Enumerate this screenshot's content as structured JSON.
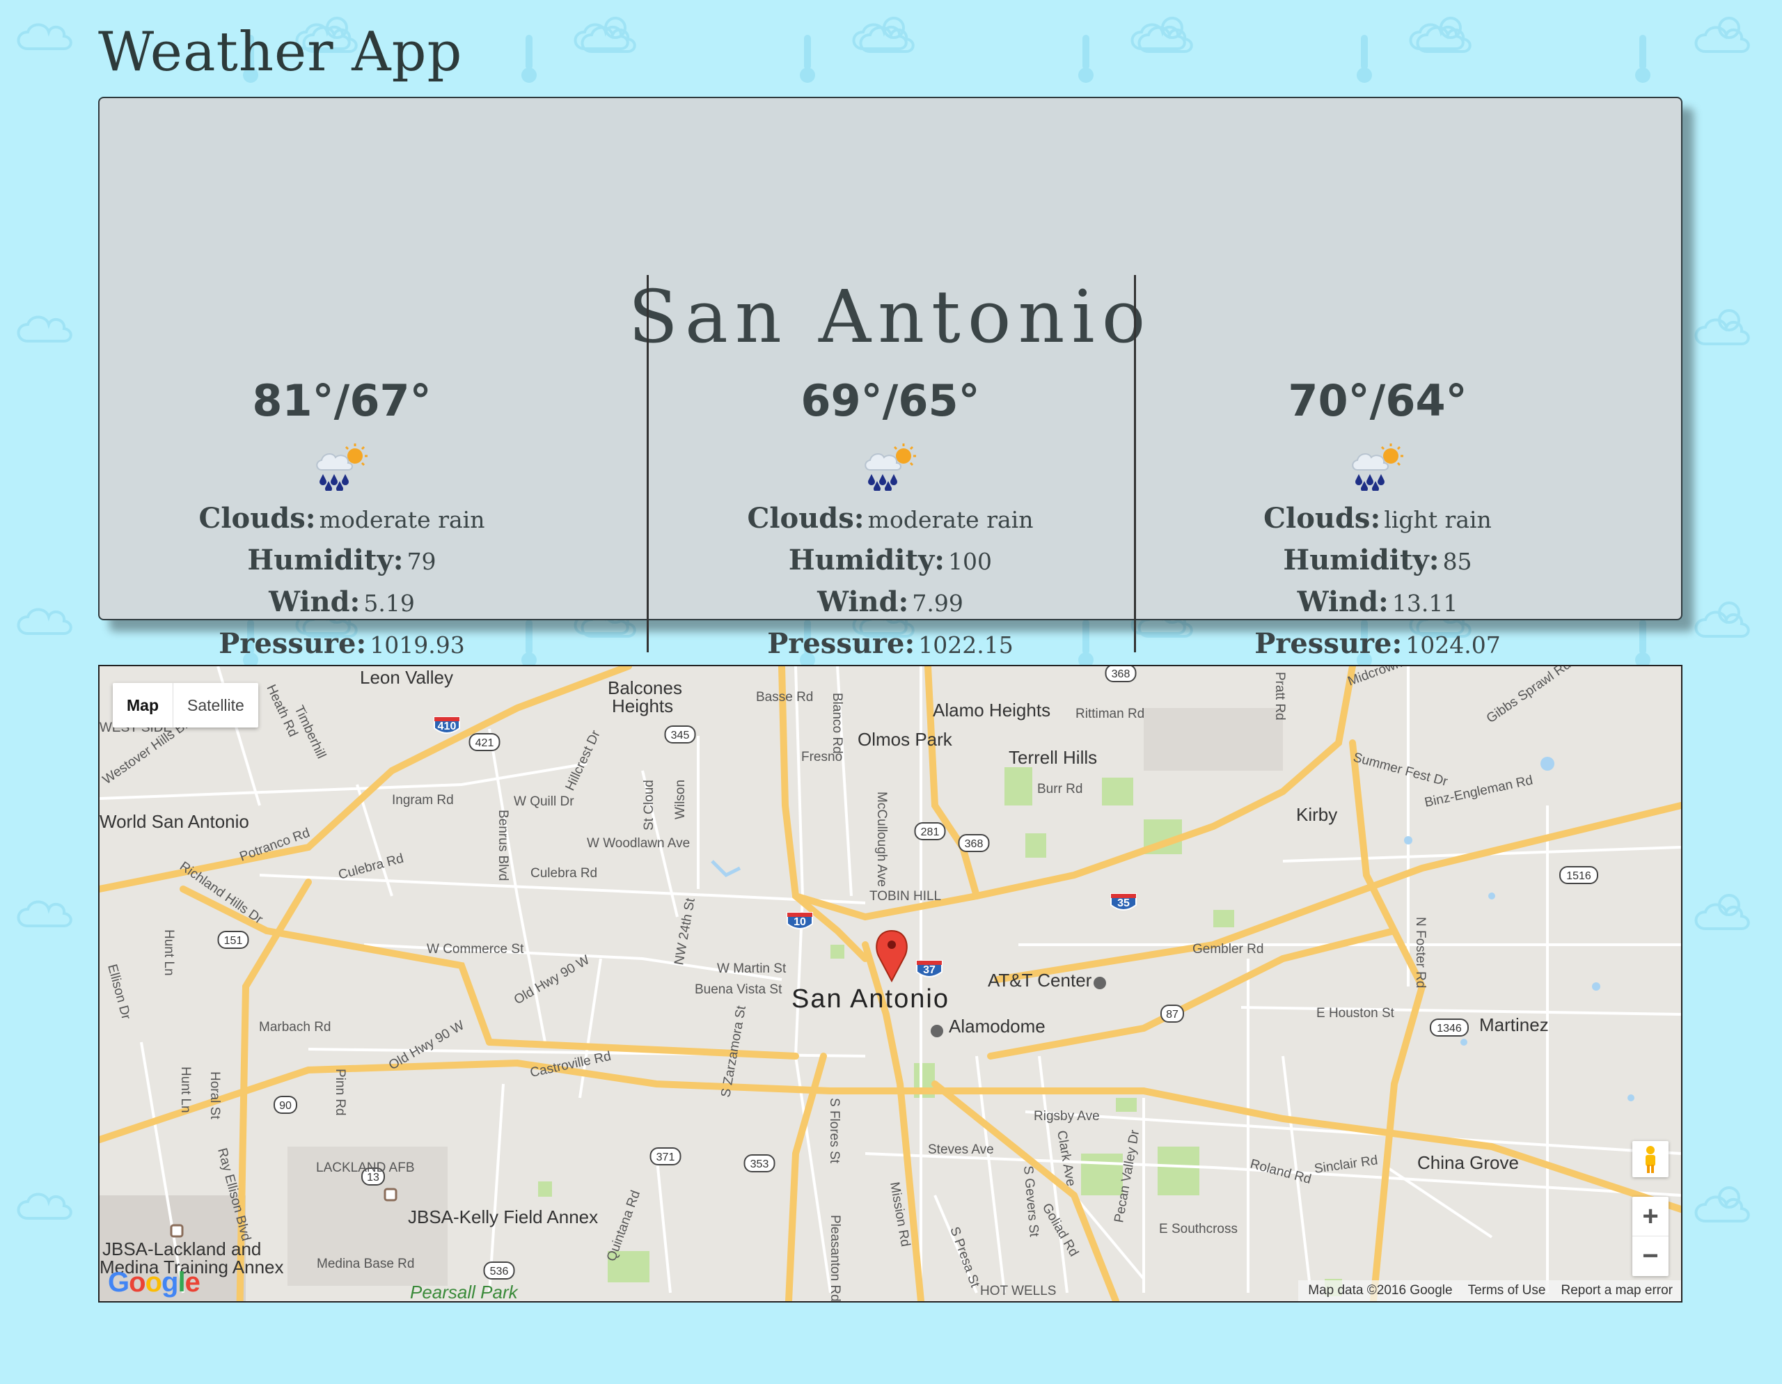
{
  "app": {
    "title": "Weather App"
  },
  "weather": {
    "city": "San Antonio",
    "labels": {
      "clouds": "Clouds:",
      "humidity": "Humidity:",
      "wind": "Wind:",
      "pressure": "Pressure:"
    },
    "days": [
      {
        "temp": "81°/67°",
        "icon": "rain-sun-icon",
        "clouds": "moderate rain",
        "humidity": "79",
        "wind": "5.19",
        "pressure": "1019.93"
      },
      {
        "temp": "69°/65°",
        "icon": "rain-sun-icon",
        "clouds": "moderate rain",
        "humidity": "100",
        "wind": "7.99",
        "pressure": "1022.15"
      },
      {
        "temp": "70°/64°",
        "icon": "rain-sun-icon",
        "clouds": "light rain",
        "humidity": "85",
        "wind": "13.11",
        "pressure": "1024.07"
      }
    ]
  },
  "map": {
    "type_control": {
      "map_label": "Map",
      "satellite_label": "Satellite",
      "selected": "Map"
    },
    "zoom": {
      "in_label": "+",
      "out_label": "−"
    },
    "attribution": {
      "data": "Map data ©2016 Google",
      "terms": "Terms of Use",
      "report": "Report a map error"
    },
    "logo": "Google",
    "labels": {
      "leon_valley": "Leon Valley",
      "balcones": "Balcones",
      "heights": "Heights",
      "alamo_heights": "Alamo Heights",
      "olmos_park": "Olmos Park",
      "terrell_hills": "Terrell Hills",
      "kirby": "Kirby",
      "west_side": "WEST SIDE",
      "world_sa": "World San Antonio",
      "tobin_hill": "TOBIN HILL",
      "san_antonio": "San Antonio",
      "att_center": "AT&T Center",
      "alamodome": "Alamodome",
      "martinez": "Martinez",
      "china_grove": "China Grove",
      "lackland_afb": "LACKLAND AFB",
      "kelly_annex": "JBSA-Kelly Field Annex",
      "jbsa_lackland": "JBSA-Lackland and",
      "medina": "Medina Training Annex",
      "pearsall_park": "Pearsall Park",
      "hot_wells": "HOT WELLS",
      "basse_rd": "Basse Rd",
      "blanco_rd": "Blanco Rd",
      "fresno": "Fresno",
      "burr_rd": "Burr Rd",
      "rittiman": "Rittiman Rd",
      "ingram": "Ingram Rd",
      "w_quill": "W Quill Dr",
      "w_woodlawn": "W Woodlawn Ave",
      "culebra": "Culebra Rd",
      "w_commerce": "W Commerce St",
      "w_martin": "W Martin St",
      "buena_vista": "Buena Vista St",
      "old_hwy_90": "Old Hwy 90 W",
      "castroville": "Castroville Rd",
      "marbach": "Marbach Rd",
      "pinn_rd": "Pinn Rd",
      "gembler": "Gembler Rd",
      "e_houston": "E Houston St",
      "rigsby": "Rigsby Ave",
      "roland": "Roland Rd",
      "sinclair": "Sinclair Rd",
      "steves": "Steves Ave",
      "se_southcross": "E Southcross",
      "medina_base": "Medina Base Rd",
      "binz": "Binz-Engleman Rd",
      "n_foster": "N Foster Rd",
      "potranco": "Potranco Rd",
      "hunt_ln": "Hunt Ln",
      "horal_st": "Horal St",
      "mission_rd": "Mission Rd",
      "pleasanton": "Pleasanton Rd",
      "quintana": "Quintana Rd",
      "s_presa": "S Presa St",
      "clark_ave": "Clark Ave",
      "s_zarzamora": "S Zarzamora St",
      "nw_24th": "NW 24th St",
      "st_cloud": "St Cloud",
      "wilson": "Wilson",
      "mccullough": "McCullough Ave",
      "hillcrest": "Hillcrest Dr",
      "benrus": "Benrus Blvd",
      "timberhill": "Timberhill",
      "heath_rd": "Heath Rd",
      "gibbs_sprawl": "Gibbs Sprawl Rd",
      "midcrown": "Midcrown Dr",
      "summer_fest": "Summer Fest Dr",
      "pecan_valley": "Pecan Valley Dr",
      "s_gevers": "S Gevers St",
      "goliad": "Goliad Rd",
      "ray_ellison": "Ray Ellison Blvd",
      "richland": "Richland Hills Dr",
      "westover": "Westover Hills Blvd",
      "culebra_rd2": "Culebra Rd",
      "ellison_dr": "Ellison Dr",
      "s_flores": "S Flores St",
      "pratt": "Pratt Rd"
    },
    "shields": [
      "410",
      "421",
      "345",
      "281",
      "368",
      "35",
      "10",
      "37",
      "87",
      "90",
      "151",
      "371",
      "353",
      "13",
      "536",
      "1516",
      "1346",
      "368"
    ]
  }
}
